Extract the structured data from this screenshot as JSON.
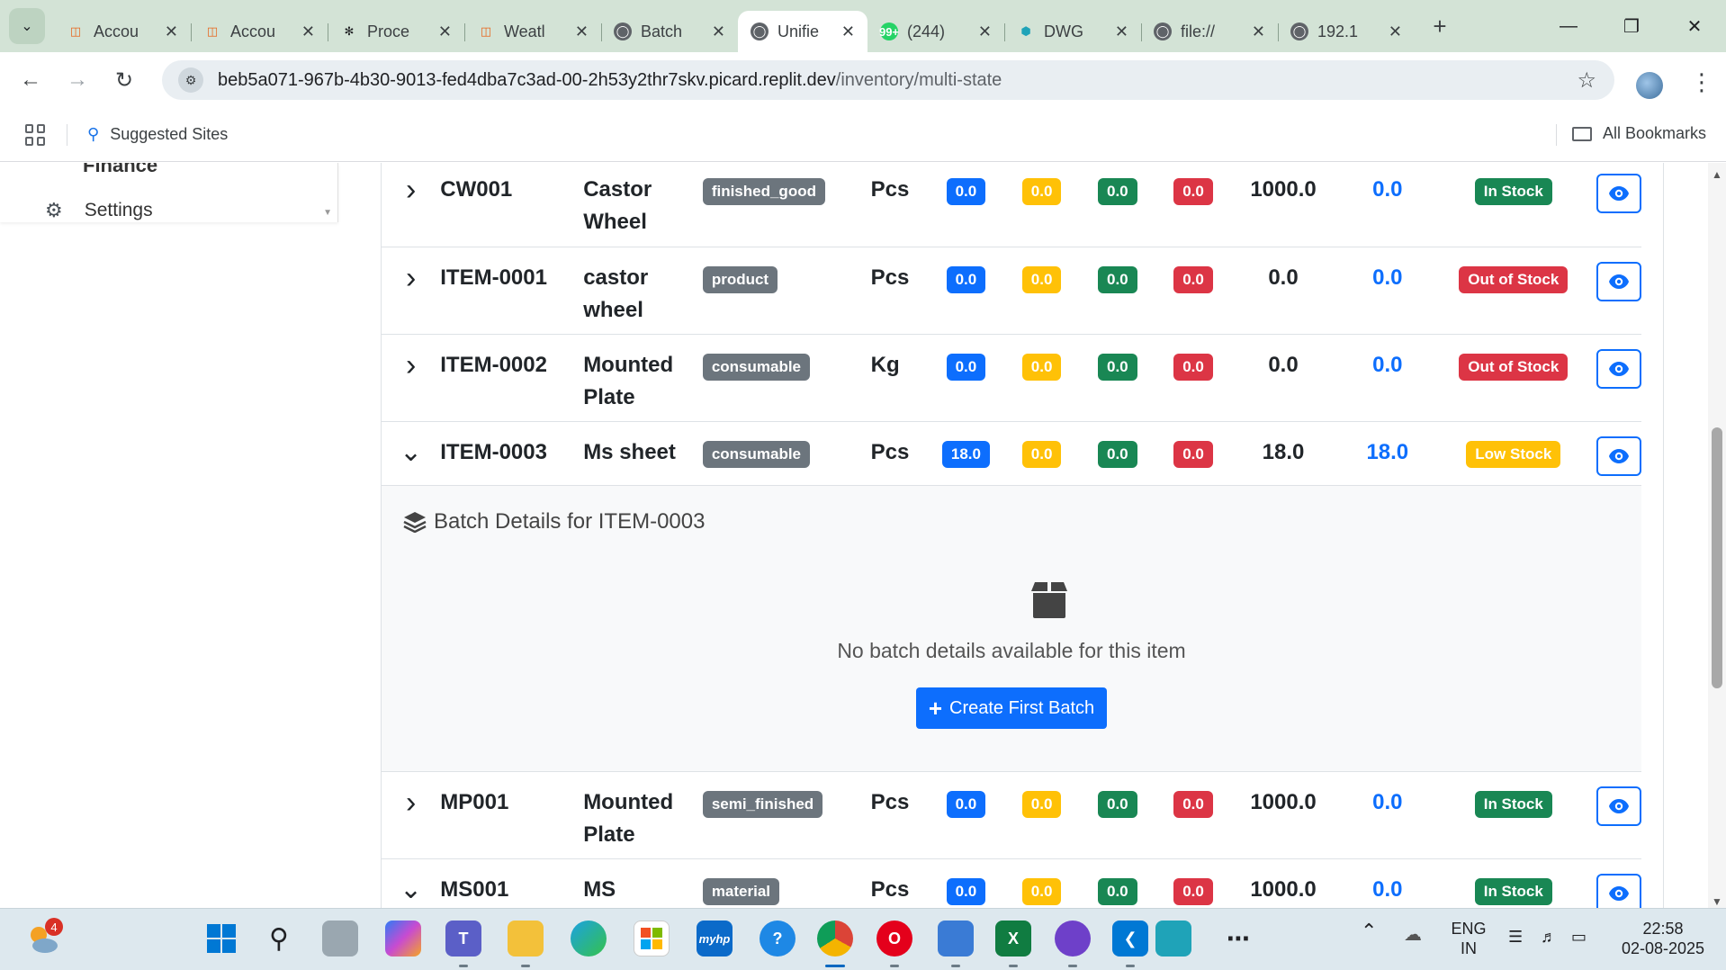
{
  "browser": {
    "tabs": [
      {
        "title": "Accou",
        "icon": "replit-icon",
        "active": false
      },
      {
        "title": "Accou",
        "icon": "replit-icon",
        "active": false
      },
      {
        "title": "Proce",
        "icon": "openai-icon",
        "active": false
      },
      {
        "title": "Weatl",
        "icon": "replit-icon",
        "active": false
      },
      {
        "title": "Batch",
        "icon": "globe-icon",
        "active": false
      },
      {
        "title": "Unifie",
        "icon": "globe-icon",
        "active": true
      },
      {
        "title": "(244)",
        "icon": "whatsapp-icon",
        "badge": "99+",
        "active": false
      },
      {
        "title": "DWG",
        "icon": "dwg-icon",
        "active": false
      },
      {
        "title": "file://",
        "icon": "globe-icon",
        "active": false
      },
      {
        "title": "192.1",
        "icon": "globe-icon",
        "active": false
      }
    ],
    "url_host": "beb5a071-967b-4b30-9013-fed4dba7c3ad-00-2h53y2thr7skv.picard.replit.dev",
    "url_path": "/inventory/multi-state",
    "bookmarks": {
      "suggested": "Suggested Sites",
      "all": "All Bookmarks"
    }
  },
  "sidebar": {
    "finance_label": "Finance",
    "settings_label": "Settings"
  },
  "inventory": {
    "rows": [
      {
        "code": "CW001",
        "name": "Castor Wheel",
        "category": "finished_good",
        "unit": "Pcs",
        "b1": "0.0",
        "b2": "0.0",
        "b3": "0.0",
        "b4": "0.0",
        "total": "1000.0",
        "available": "0.0",
        "status": "In Stock",
        "status_kind": "green",
        "toggle": "collapsed"
      },
      {
        "code": "ITEM-0001",
        "name": "castor wheel",
        "category": "product",
        "unit": "Pcs",
        "b1": "0.0",
        "b2": "0.0",
        "b3": "0.0",
        "b4": "0.0",
        "total": "0.0",
        "available": "0.0",
        "status": "Out of Stock",
        "status_kind": "red",
        "toggle": "collapsed"
      },
      {
        "code": "ITEM-0002",
        "name": "Mounted Plate",
        "category": "consumable",
        "unit": "Kg",
        "b1": "0.0",
        "b2": "0.0",
        "b3": "0.0",
        "b4": "0.0",
        "total": "0.0",
        "available": "0.0",
        "status": "Out of Stock",
        "status_kind": "red",
        "toggle": "collapsed"
      },
      {
        "code": "ITEM-0003",
        "name": "Ms sheet",
        "category": "consumable",
        "unit": "Pcs",
        "b1": "18.0",
        "b2": "0.0",
        "b3": "0.0",
        "b4": "0.0",
        "total": "18.0",
        "available": "18.0",
        "status": "Low Stock",
        "status_kind": "yellow",
        "toggle": "expanded"
      },
      {
        "code": "MP001",
        "name": "Mounted Plate",
        "category": "semi_finished",
        "unit": "Pcs",
        "b1": "0.0",
        "b2": "0.0",
        "b3": "0.0",
        "b4": "0.0",
        "total": "1000.0",
        "available": "0.0",
        "status": "In Stock",
        "status_kind": "green",
        "toggle": "collapsed"
      },
      {
        "code": "MS001",
        "name": "MS",
        "category": "material",
        "unit": "Pcs",
        "b1": "0.0",
        "b2": "0.0",
        "b3": "0.0",
        "b4": "0.0",
        "total": "1000.0",
        "available": "0.0",
        "status": "In Stock",
        "status_kind": "green",
        "toggle": "expanded"
      }
    ],
    "batch_panel": {
      "title": "Batch Details for ITEM-0003",
      "empty_message": "No batch details available for this item",
      "create_button": "Create First Batch"
    }
  },
  "taskbar": {
    "weather_badge": "4",
    "language": "ENG",
    "region": "IN",
    "time": "22:58",
    "date": "02-08-2025"
  },
  "colors": {
    "primary": "#0d6efd",
    "warning": "#ffc107",
    "success": "#198754",
    "danger": "#dc3545",
    "secondary": "#6c757d",
    "chrome_frame": "#d3e3d6"
  }
}
